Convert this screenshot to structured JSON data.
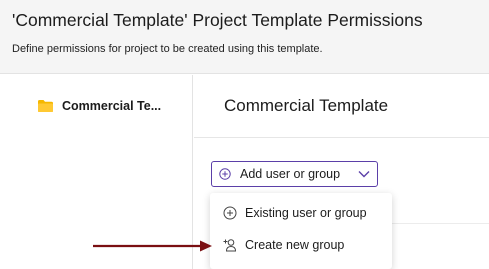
{
  "header": {
    "title": "'Commercial Template' Project Template Permissions",
    "subtitle": "Define permissions for project to be created using this template."
  },
  "sidebar": {
    "items": [
      {
        "label": "Commercial Te...",
        "icon": "folder-icon",
        "icon_color": "#f5b800"
      }
    ]
  },
  "main": {
    "title": "Commercial Template",
    "add_button": {
      "label": "Add user or group",
      "icon": "plus-circle-icon",
      "border_color": "#5b3fa8"
    },
    "dropdown": {
      "items": [
        {
          "label": "Existing user or group",
          "icon": "plus-circle-icon"
        },
        {
          "label": "Create new group",
          "icon": "add-user-icon"
        }
      ]
    }
  },
  "annotation": {
    "arrow_color": "#7a0f12"
  }
}
